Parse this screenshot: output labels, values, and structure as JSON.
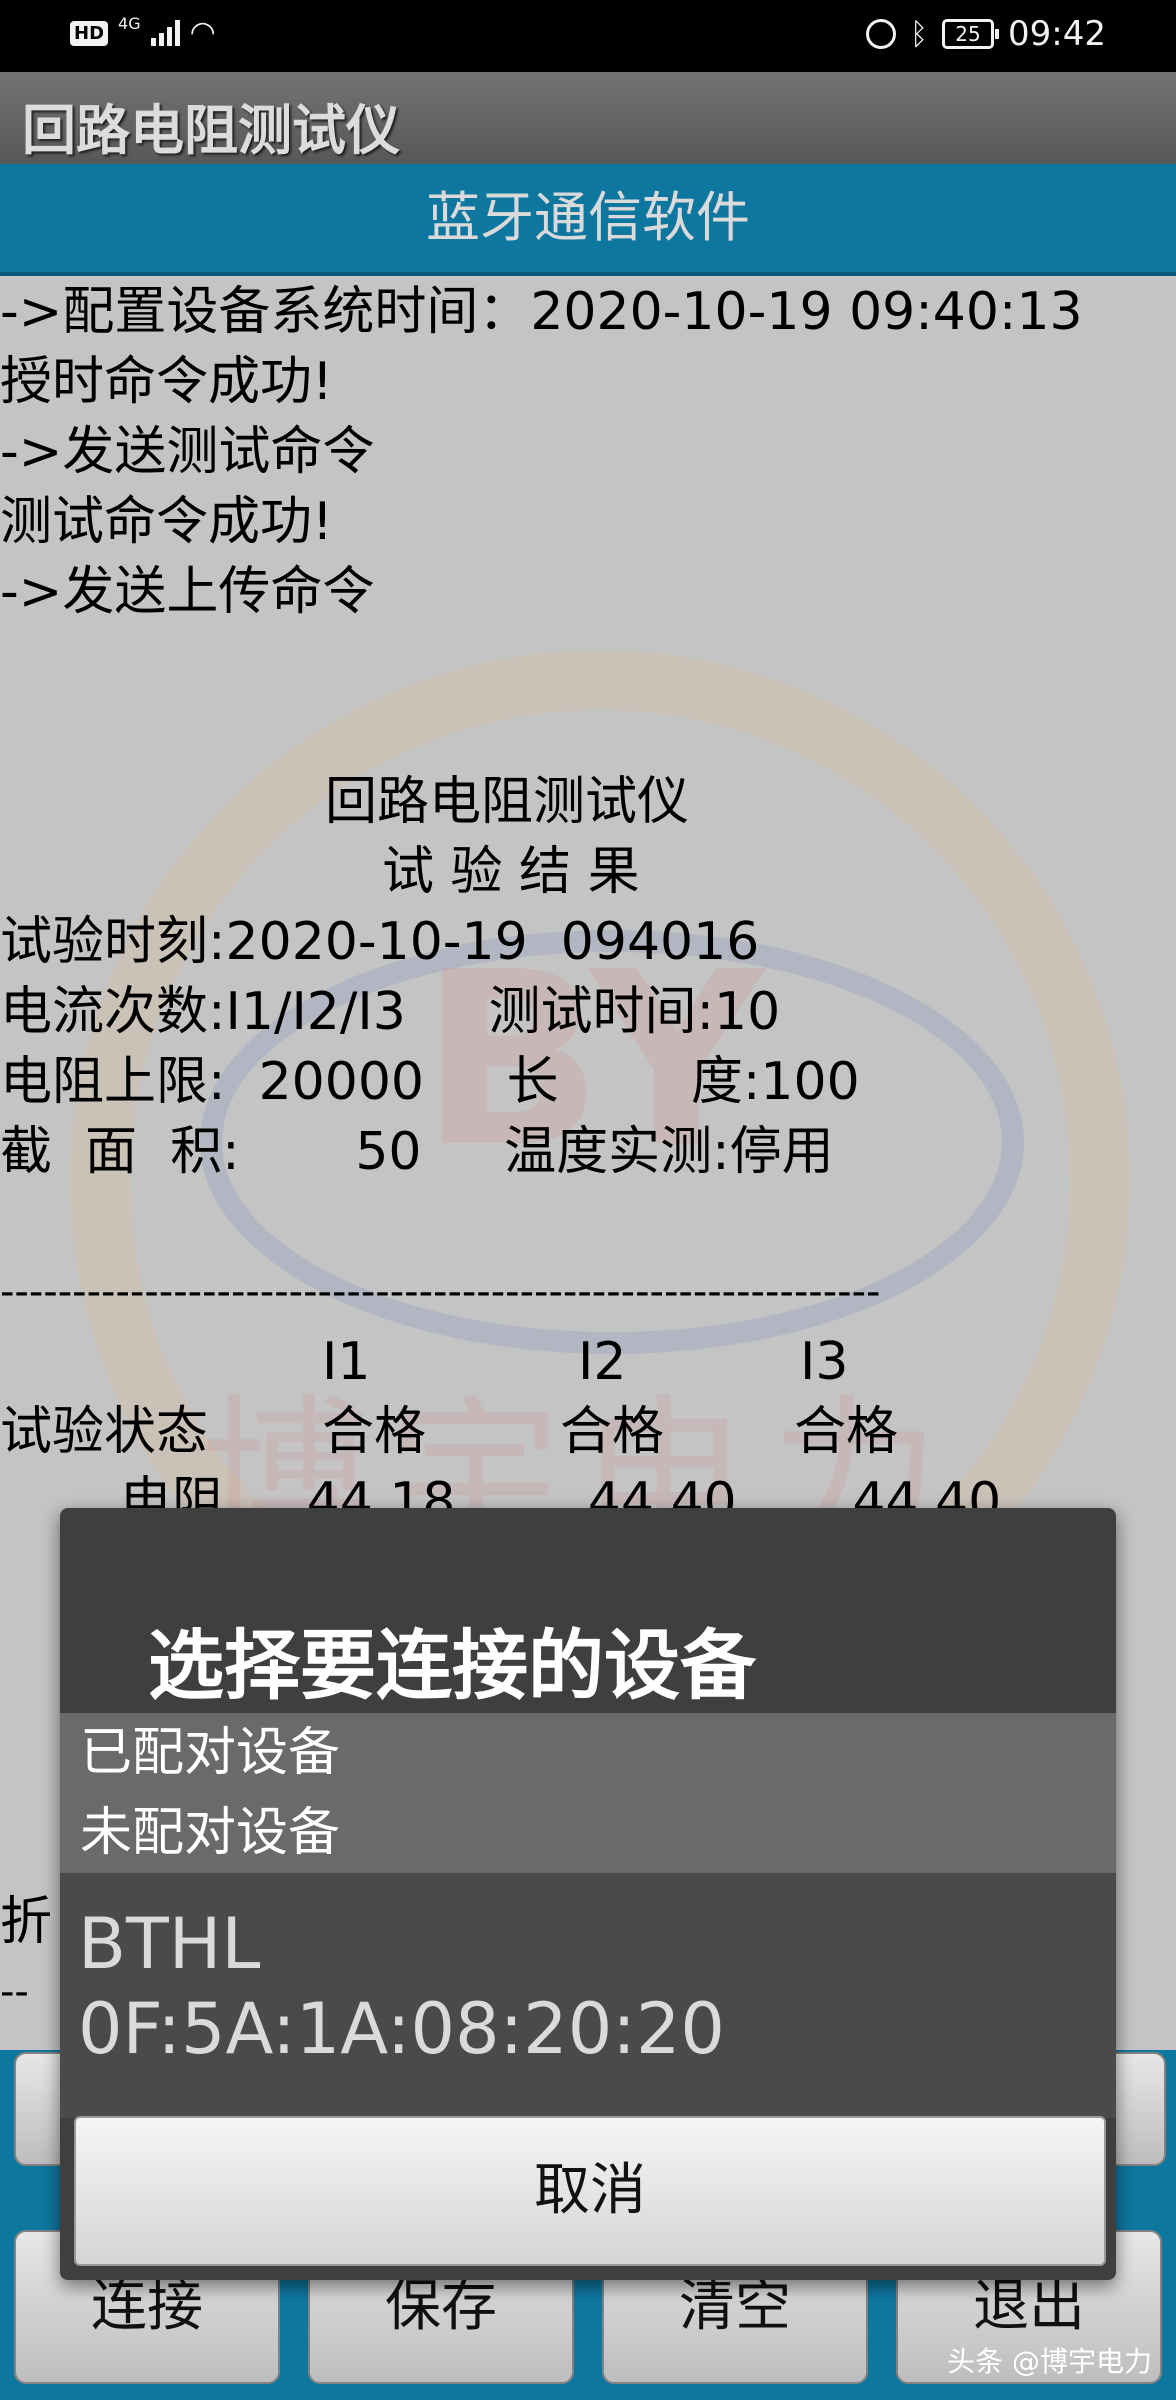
{
  "status_bar": {
    "hd": "HD",
    "network": "4G",
    "time": "09:42",
    "battery": "25"
  },
  "app": {
    "title": "回路电阻测试仪",
    "subtitle": "蓝牙通信软件"
  },
  "log": {
    "lines": [
      "->配置设备系统时间：2020-10-19 09:40:13",
      "授时命令成功!",
      "->发送测试命令",
      "测试命令成功!",
      "->发送上传命令"
    ]
  },
  "report": {
    "device_name": "回路电阻测试仪",
    "heading": "试 验 结 果",
    "test_time": "试验时刻:2020-10-19  094016",
    "current_line": "电流次数:I1/I2/I3     测试时间:10",
    "limit_line": "电阻上限:  20000     长        度:100",
    "area_line": "截  面  积:       50     温度实测:停用",
    "divider": "-------------------------------------------------------------",
    "col_i1": "I1",
    "col_i2": "I2",
    "col_i3": "I3",
    "status_label": "试验状态",
    "status_i1": "合格",
    "status_i2": "合格",
    "status_i3": "合格",
    "resistance_partial": "电阻     44.18        44.40       44.40",
    "partial_left": "折",
    "partial_dash": "--"
  },
  "watermark": {
    "letters": "BY",
    "text": "博宇电力"
  },
  "buttons": {
    "connect": "连接",
    "save": "保存",
    "clear": "清空",
    "exit": "退出"
  },
  "dialog": {
    "title": "选择要连接的设备",
    "paired": "已配对设备",
    "unpaired": "未配对设备",
    "device_name": "BTHL",
    "device_address": "0F:5A:1A:08:20:20",
    "cancel": "取消"
  },
  "credit": "头条 @博宇电力"
}
